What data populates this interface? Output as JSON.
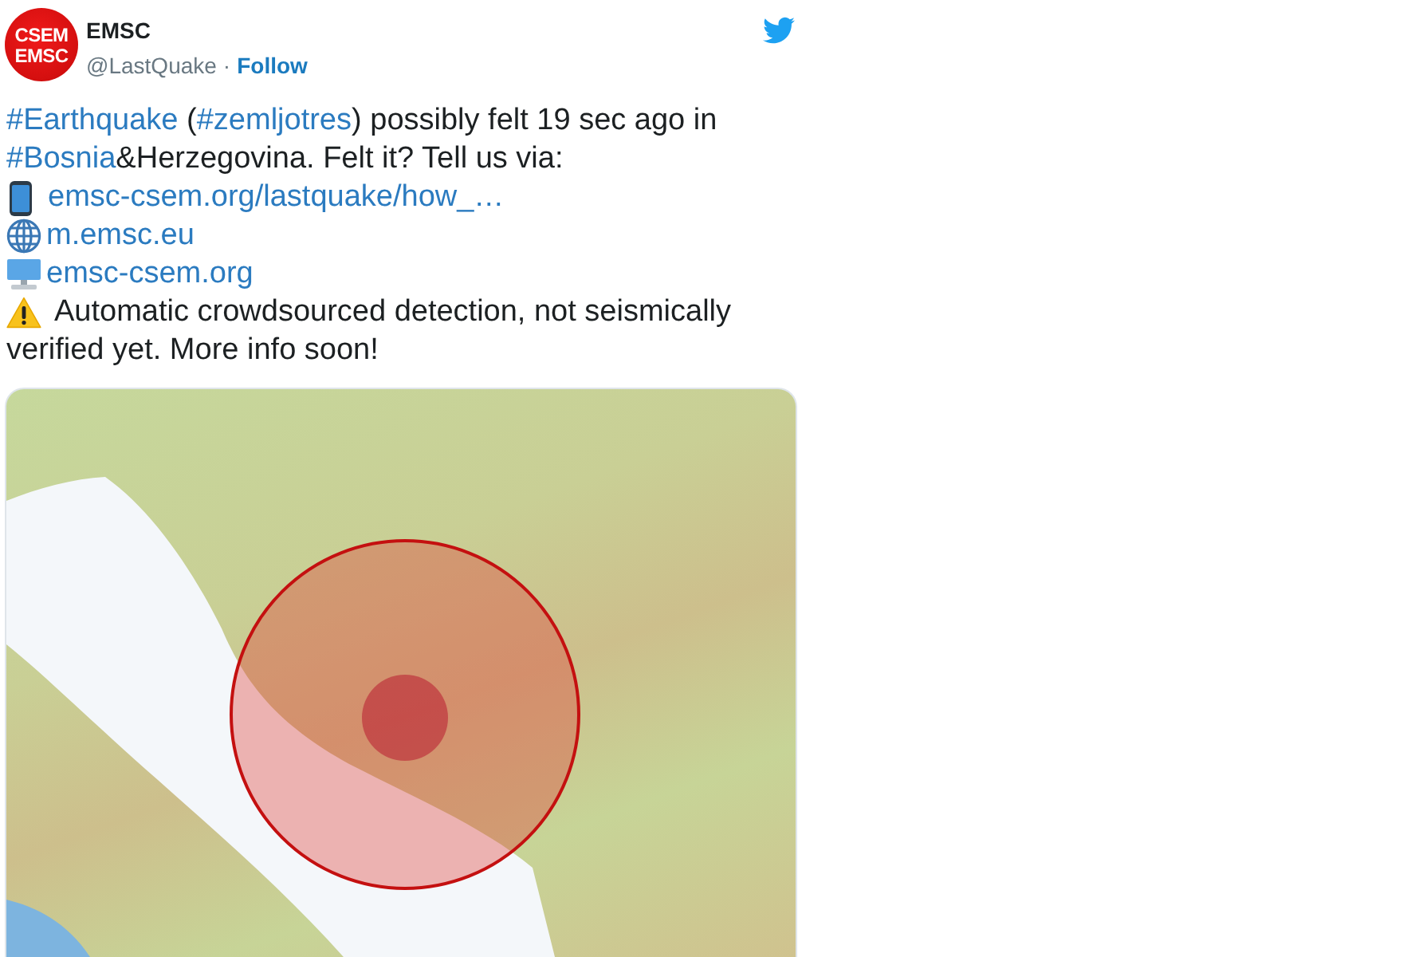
{
  "author": {
    "avatar_lines": [
      "CSEM",
      "EMSC"
    ],
    "name": "EMSC",
    "handle": "@LastQuake",
    "separator": "·",
    "follow": "Follow"
  },
  "tweet": {
    "intro": [
      {
        "kind": "hashtag",
        "text": "#Earthquake"
      },
      {
        "kind": "plain",
        "text": " ("
      },
      {
        "kind": "hashtag",
        "text": "#zemljotres"
      },
      {
        "kind": "plain",
        "text": ") possibly felt 19 sec ago in "
      },
      {
        "kind": "hashtag",
        "text": "#Bosnia"
      },
      {
        "kind": "plain",
        "text": "&Herzegovina. Felt it? Tell us via:"
      }
    ],
    "links": [
      {
        "kind": "phone",
        "text": "emsc-csem.org/lastquake/how_…"
      },
      {
        "kind": "globe",
        "text": "m.emsc.eu"
      },
      {
        "kind": "computer",
        "text": "emsc-csem.org"
      }
    ],
    "notice_lines": [
      "Automatic crowdsourced detection, not seismically",
      "verified yet. More info soon!"
    ]
  }
}
